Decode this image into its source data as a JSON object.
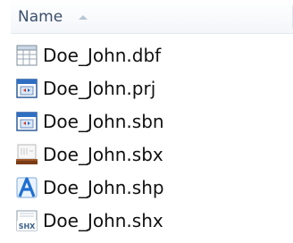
{
  "header": {
    "name_label": "Name"
  },
  "files": [
    {
      "name": "Doe_John.dbf",
      "icon": "table-file-icon"
    },
    {
      "name": "Doe_John.prj",
      "icon": "window-file-icon"
    },
    {
      "name": "Doe_John.sbn",
      "icon": "window-file-icon"
    },
    {
      "name": "Doe_John.sbx",
      "icon": "image-file-icon"
    },
    {
      "name": "Doe_John.shp",
      "icon": "shape-file-icon"
    },
    {
      "name": "Doe_John.shx",
      "icon": "shx-file-icon",
      "icon_text": "SHX"
    }
  ]
}
